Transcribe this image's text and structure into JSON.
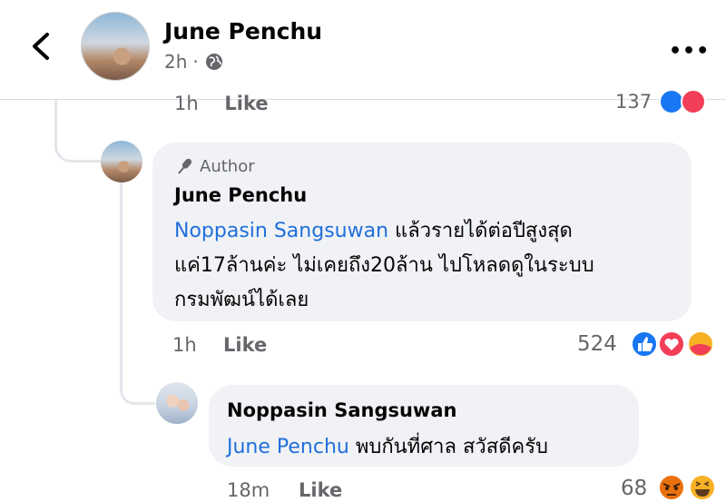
{
  "header": {
    "author_name": "June Penchu",
    "time": "2h",
    "separator": "·",
    "icons": [
      "back-icon",
      "globe-icon",
      "more-icon"
    ]
  },
  "previous_comment": {
    "time": "1h",
    "like_label": "Like",
    "reaction_count": "137",
    "reactions": [
      "like-reaction",
      "love-reaction"
    ]
  },
  "comments": [
    {
      "badge_label": "Author",
      "badge_icon": "microphone-icon",
      "author": "June Penchu",
      "mention": "Noppasin Sangsuwan",
      "text_line1": "แล้วรายได้ต่อปีสูงสุด",
      "text_line2": "แค่17ล้านค่ะ ไม่เคยถึง20ล้าน ไปโหลดดูในระบบ",
      "text_line3": "กรมพัฒน์ได้เลย",
      "time": "1h",
      "like_label": "Like",
      "reaction_count": "524",
      "reactions": [
        "like-reaction",
        "love-reaction",
        "care-reaction"
      ]
    },
    {
      "author": "Noppasin Sangsuwan",
      "mention": "June Penchu",
      "text": "พบกันที่ศาล สวัสดีครับ",
      "time": "18m",
      "like_label": "Like",
      "reaction_count": "68",
      "reactions": [
        "angry-reaction",
        "haha-reaction"
      ]
    }
  ],
  "colors": {
    "mention_blue": "#216fdb",
    "bubble_bg": "#f0f2f5",
    "meta_gray": "#65676b",
    "like_blue": "#1877f2",
    "love_red": "#f33e58"
  }
}
